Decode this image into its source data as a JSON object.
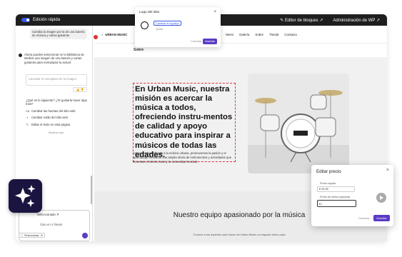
{
  "topbar": {
    "quick_edit": "Edición rápida",
    "block_editor": "Editor de bloques",
    "wp_admin": "Administración de WP"
  },
  "chat": {
    "user_msg": "Cambia la imagen por la de una batería de música y varias guitarras",
    "ai_msg": "Ahora puedes seleccionar en la Biblioteca de Medios una imagen de una batería y varias guitarras para reemplazar la actual.",
    "preview_placeholder": "Cancelar el reemplazo de la imagen",
    "next_q": "¿Qué es lo siguiente? ¿Te gustaría hacer algo más?",
    "suggestions": [
      {
        "icon": "Aa",
        "label": "Cambiar las fuentes del sitio web"
      },
      {
        "icon": "◐",
        "label": "Cambiar estilo del sitio web"
      },
      {
        "icon": "✎",
        "label": "Editar el texto en esta página"
      }
    ],
    "more": "Mostrar más",
    "selected_chip": "Seleccionado",
    "input_text": "Ciao en 4 líneas",
    "selected_chip2": "Seleccionar"
  },
  "site": {
    "brand": "URBAN MUSIC",
    "nav": [
      "Menú",
      "Galería",
      "Sobre",
      "Tienda",
      "Contacto"
    ],
    "subnav": "Sobre",
    "heading": "En Urban Music, nuestra misión es acercar la música a todos, ofreciendo instru-mentos de calidad y apoyo educativo para inspirar a músicos de todas las edades.",
    "paragraph": "Como tienda dedicada a la música urbana, promovemos la pasión y el aprendizaje mediante una amplia oferta de instrumentos y actividades que fomentan el talento local y la comunidad musical.",
    "team_heading": "Nuestro equipo apasionado por la música",
    "team_para": "Conoce a los expertos que hacen de Urban Music un espacio único para"
  },
  "logo_dialog": {
    "title": "Logo del sitio",
    "replace_btn": "Cambiar el logotipo",
    "remove": "Quitar",
    "cancel": "Cancelar",
    "save": "Guardar"
  },
  "price_dialog": {
    "title": "Editar precio",
    "regular_label": "Precio regular",
    "regular_value": "€  49.99",
    "sale_label": "Precio de oferta (opcional)",
    "sale_value": "€  |",
    "cancel": "Cancelar",
    "save": "Guardar"
  }
}
